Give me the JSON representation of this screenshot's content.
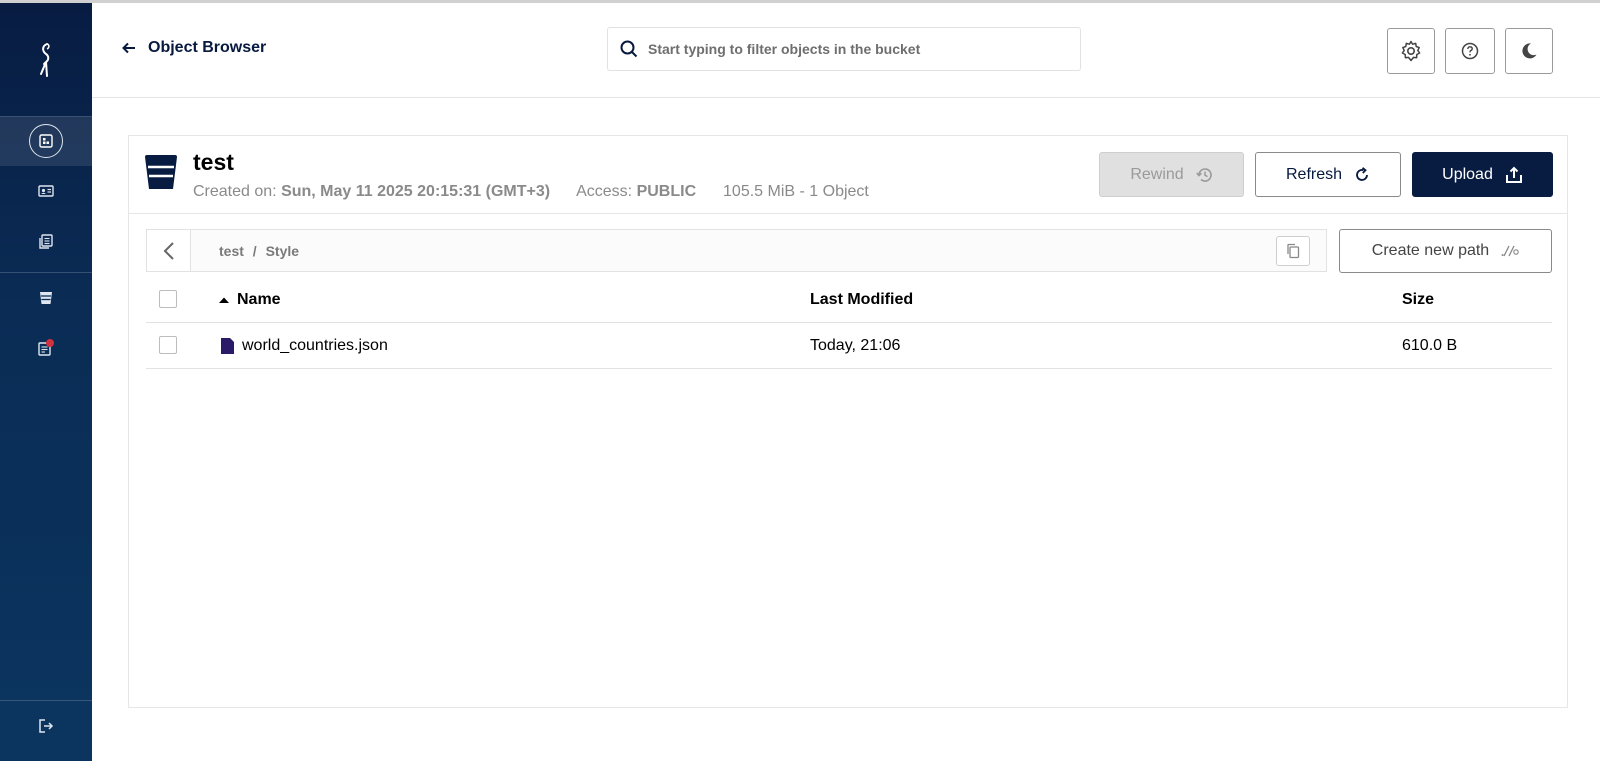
{
  "sidebar": {
    "logo_icon": "minio-bird-logo-icon",
    "items": [
      {
        "name": "object-browser",
        "icon": "object-browser-icon",
        "active": true
      },
      {
        "name": "access-keys",
        "icon": "access-keys-icon",
        "active": false
      },
      {
        "name": "documentation",
        "icon": "documentation-icon",
        "active": false
      },
      {
        "name": "buckets",
        "icon": "bucket-icon",
        "active": false
      },
      {
        "name": "license",
        "icon": "license-icon",
        "active": false,
        "badge": true
      }
    ],
    "logout_icon": "logout-icon"
  },
  "header": {
    "back_label": "Object Browser",
    "search_placeholder": "Start typing to filter objects in the bucket",
    "buttons": [
      "settings-icon",
      "help-icon",
      "dark-mode-icon"
    ]
  },
  "bucket": {
    "name": "test",
    "created_label": "Created on:",
    "created_value": "Sun, May 11 2025 20:15:31 (GMT+3)",
    "access_label": "Access:",
    "access_value": "PUBLIC",
    "summary": "105.5 MiB - 1 Object",
    "rewind_label": "Rewind",
    "refresh_label": "Refresh",
    "upload_label": "Upload"
  },
  "path": {
    "root": "test",
    "separator": "/",
    "folder": "Style",
    "create_label": "Create new path"
  },
  "table": {
    "headers": {
      "name": "Name",
      "modified": "Last Modified",
      "size": "Size"
    },
    "rows": [
      {
        "name": "world_countries.json",
        "modified": "Today, 21:06",
        "size": "610.0 B"
      }
    ]
  },
  "colors": {
    "sidebar": "#081c42",
    "primary": "#081c42",
    "file_icon": "#2b1a68",
    "badge": "#d1313f"
  }
}
